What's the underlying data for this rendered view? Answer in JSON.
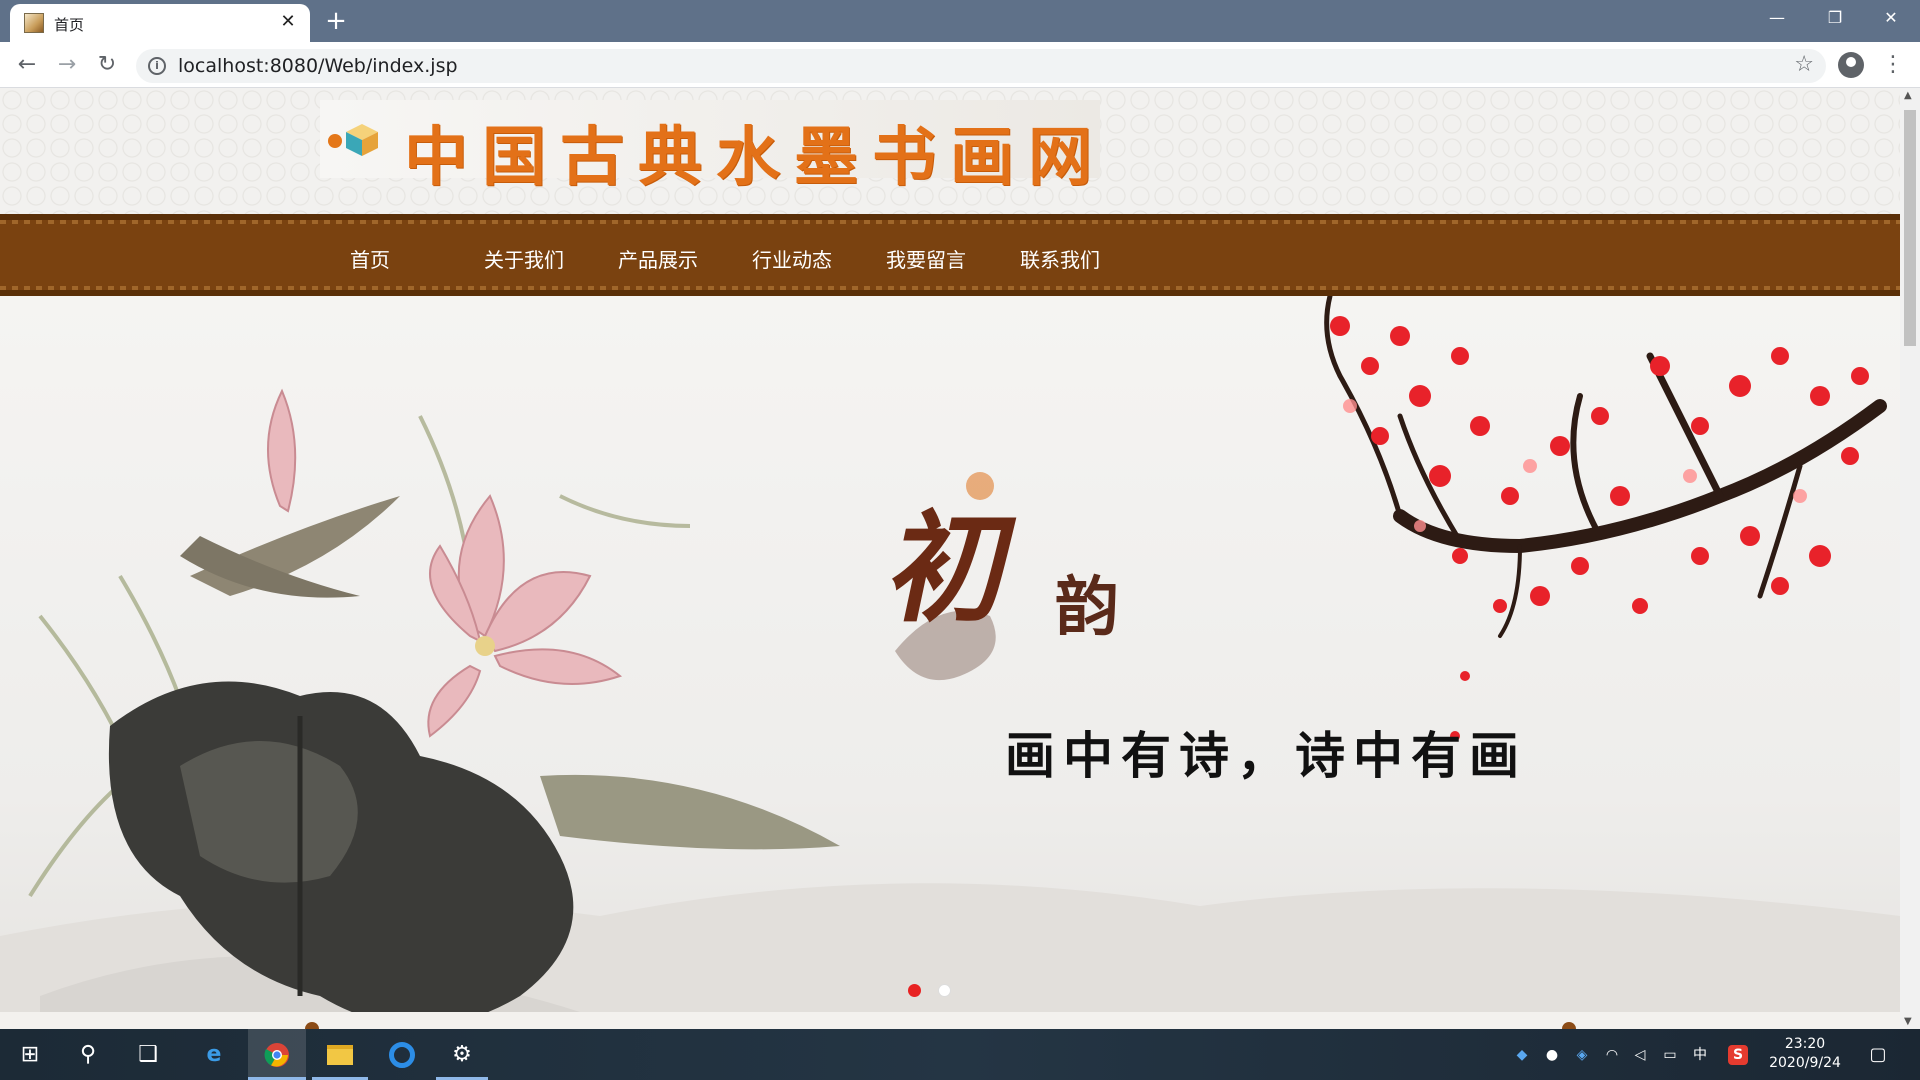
{
  "browser": {
    "tab_title": "首页",
    "tab_close": "✕",
    "new_tab": "+",
    "url": "localhost:8080/Web/index.jsp",
    "window_controls": {
      "minimize": "—",
      "restore": "❐",
      "close": "✕"
    }
  },
  "site": {
    "logo_text": "中国古典水墨书画网",
    "nav": [
      "首页",
      "关于我们",
      "产品展示",
      "行业动态",
      "我要留言",
      "联系我们"
    ],
    "banner": {
      "brand_main": "初",
      "brand_sub": "韵",
      "motto": "画中有诗，诗中有画",
      "slides": 2,
      "active_slide": 1
    }
  },
  "colors": {
    "nav_bg": "#7a4210",
    "logo_text": "#e37118",
    "active_dot": "#e82222"
  },
  "taskbar": {
    "clock_time": "23:20",
    "clock_date": "2020/9/24",
    "ime": "中",
    "apps": [
      "start-icon",
      "search-icon",
      "task-view-icon",
      "edge-icon",
      "chrome-icon",
      "file-explorer-icon",
      "qq-browser-icon",
      "app-icon"
    ]
  }
}
